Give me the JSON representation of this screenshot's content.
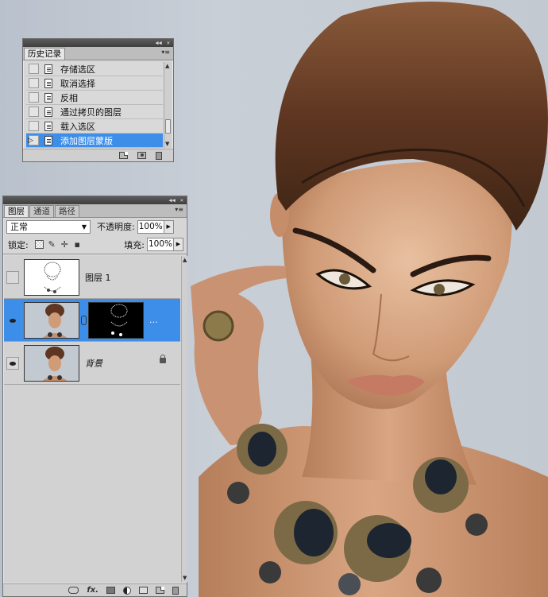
{
  "colors": {
    "selection": "#3d8ee9",
    "panel_bg": "#d6d6d6",
    "canvas_bg": "#c5cbd3"
  },
  "history_panel": {
    "tab_label": "历史记录",
    "items": [
      {
        "label": "存储选区",
        "selected": false
      },
      {
        "label": "取消选择",
        "selected": false
      },
      {
        "label": "反相",
        "selected": false
      },
      {
        "label": "通过拷贝的图层",
        "selected": false
      },
      {
        "label": "载入选区",
        "selected": false
      },
      {
        "label": "添加图层蒙版",
        "selected": true
      }
    ],
    "footer_icons": [
      "new-document-icon",
      "camera-icon",
      "trash-icon"
    ]
  },
  "layers_panel": {
    "tabs": [
      "图层",
      "通道",
      "路径"
    ],
    "blend_mode": "正常",
    "opacity_label": "不透明度:",
    "opacity_value": "100%",
    "lock_label": "锁定:",
    "fill_label": "填充:",
    "fill_value": "100%",
    "layers": [
      {
        "name": "图层 1",
        "visible": false,
        "selected": false,
        "thumb": "sketch"
      },
      {
        "name": "",
        "visible": true,
        "selected": true,
        "thumb": "photo",
        "has_mask": true,
        "ellipsis": "..."
      },
      {
        "name": "背景",
        "visible": true,
        "selected": false,
        "thumb": "photo",
        "locked": true
      }
    ],
    "footer_icons": [
      "link-icon",
      "fx-icon",
      "mask-icon",
      "adjustment-icon",
      "group-icon",
      "new-layer-icon",
      "trash-icon"
    ],
    "fx_label": "fx."
  }
}
